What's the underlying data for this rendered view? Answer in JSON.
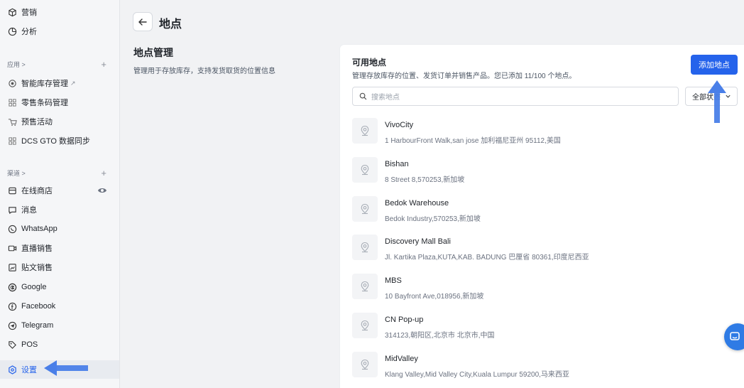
{
  "sidebar": {
    "top_items": [
      {
        "label": "营销",
        "icon": "megaphone-icon"
      },
      {
        "label": "分析",
        "icon": "chart-icon"
      }
    ],
    "apps_section": {
      "label": "应用 >",
      "add": "+"
    },
    "app_items": [
      {
        "label": "智能库存管理",
        "icon": "inventory-icon",
        "external": "↗"
      },
      {
        "label": "零售条码管理",
        "icon": "barcode-icon"
      },
      {
        "label": "预售活动",
        "icon": "presale-icon"
      },
      {
        "label": "DCS GTO 数据同步",
        "icon": "sync-icon"
      }
    ],
    "channels_section": {
      "label": "渠道 >",
      "add": "+"
    },
    "channel_items": [
      {
        "label": "在线商店",
        "icon": "store-icon"
      },
      {
        "label": "消息",
        "icon": "message-icon"
      },
      {
        "label": "WhatsApp",
        "icon": "whatsapp-icon"
      },
      {
        "label": "直播销售",
        "icon": "live-icon"
      },
      {
        "label": "贴文销售",
        "icon": "post-icon"
      },
      {
        "label": "Google",
        "icon": "google-icon"
      },
      {
        "label": "Facebook",
        "icon": "facebook-icon"
      },
      {
        "label": "Telegram",
        "icon": "telegram-icon"
      },
      {
        "label": "POS",
        "icon": "pos-icon"
      }
    ],
    "settings": {
      "label": "设置",
      "icon": "gear-icon"
    }
  },
  "header": {
    "title": "地点"
  },
  "section": {
    "title": "地点管理",
    "description": "管理用于存放库存，支持发货取货的位置信息"
  },
  "card": {
    "title": "可用地点",
    "description": "管理存放库存的位置、发货订单并销售产品。您已添加 11/100 个地点。",
    "add_button": "添加地点",
    "search_placeholder": "搜索地点",
    "status_filter": "全部状态"
  },
  "locations": [
    {
      "name": "VivoCity",
      "address": "1 HarbourFront Walk,san jose 加利福尼亚州 95112,美国"
    },
    {
      "name": "Bishan",
      "address": "8 Street 8,570253,新加坡"
    },
    {
      "name": "Bedok Warehouse",
      "address": "Bedok Industry,570253,新加坡"
    },
    {
      "name": "Discovery Mall Bali",
      "address": "Jl. Kartika Plaza,KUTA,KAB. BADUNG 巴厘省 80361,印度尼西亚"
    },
    {
      "name": "MBS",
      "address": "10 Bayfront Ave,018956,新加坡"
    },
    {
      "name": "CN Pop-up",
      "address": "314123,朝阳区,北京市 北京市,中国"
    },
    {
      "name": "MidValley",
      "address": "Klang Valley,Mid Valley City,Kuala Lumpur 59200,马来西亚"
    }
  ],
  "colors": {
    "accent": "#2563eb",
    "annotation_arrow": "#4a7fe8",
    "chat": "#2f7be5"
  }
}
